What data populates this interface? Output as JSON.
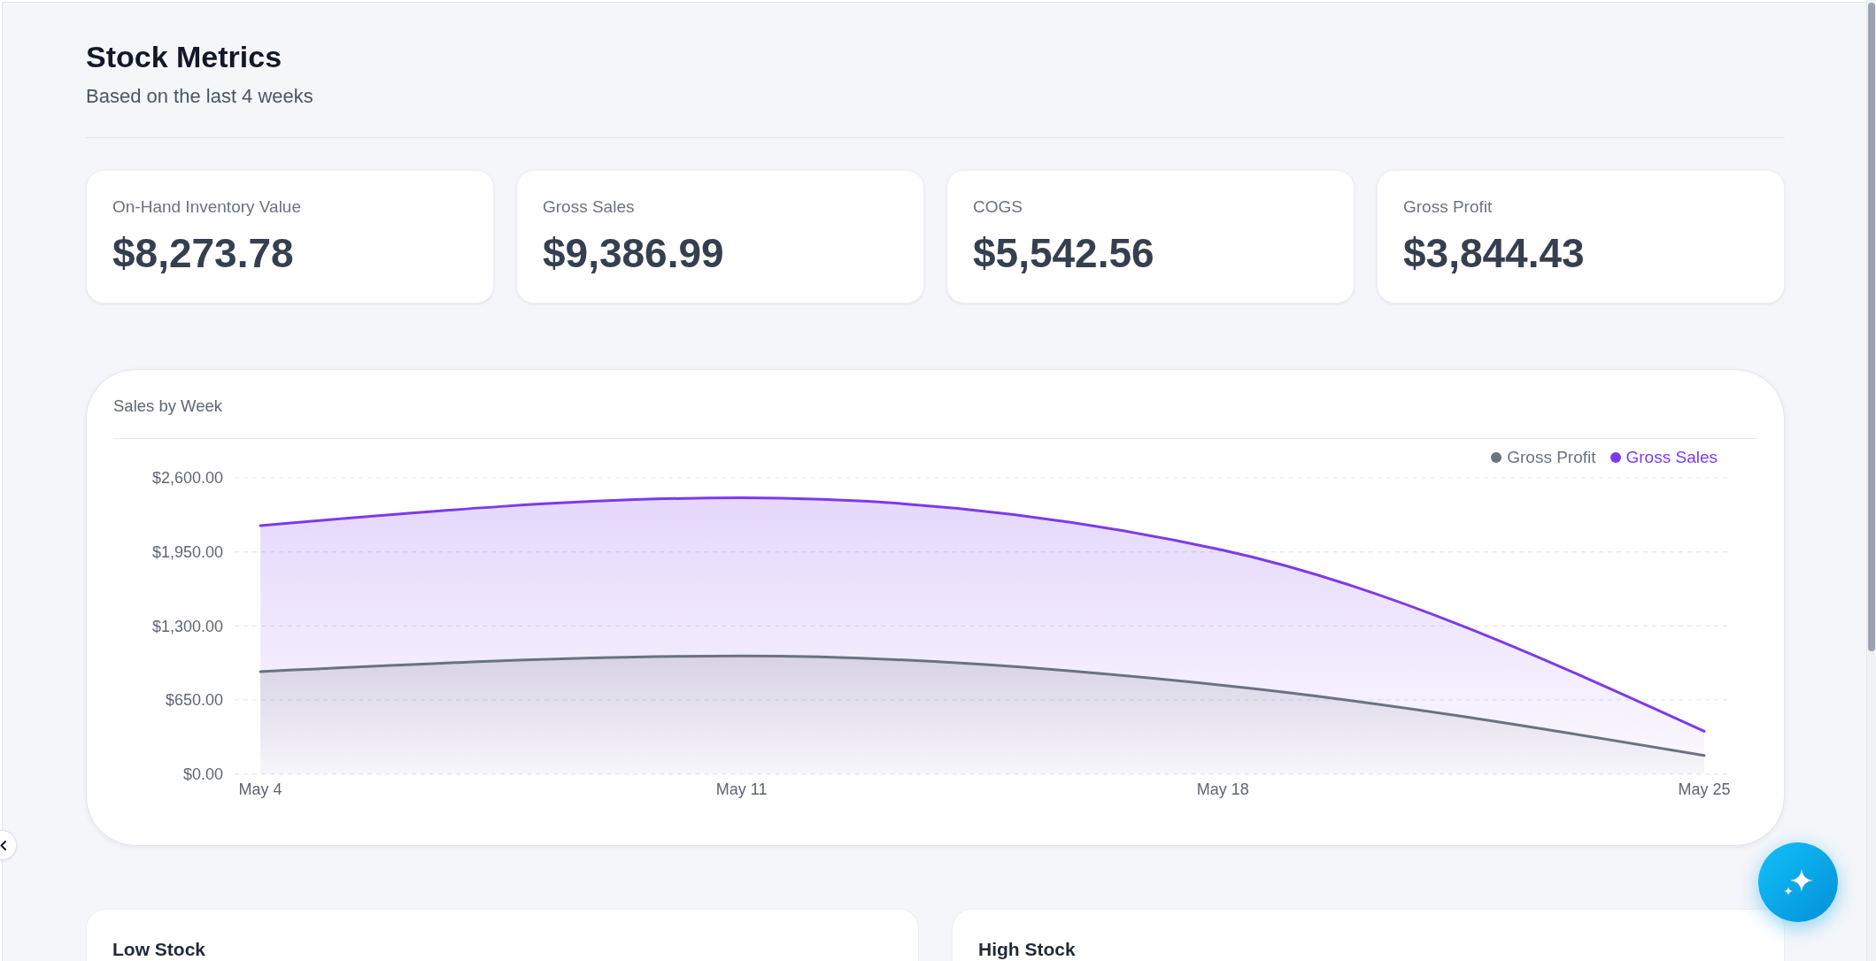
{
  "header": {
    "title": "Stock Metrics",
    "subtitle": "Based on the last 4 weeks"
  },
  "metrics": [
    {
      "label": "On-Hand Inventory Value",
      "value": "$8,273.78"
    },
    {
      "label": "Gross Sales",
      "value": "$9,386.99"
    },
    {
      "label": "COGS",
      "value": "$5,542.56"
    },
    {
      "label": "Gross Profit",
      "value": "$3,844.43"
    }
  ],
  "sales_chart": {
    "title": "Sales by Week",
    "chart_data": {
      "type": "area",
      "grid": true,
      "categories": [
        "May 4",
        "May 11",
        "May 18",
        "May 25"
      ],
      "series": [
        {
          "name": "Gross Profit",
          "color": "#6b7280",
          "values": [
            899,
            1036,
            778,
            162
          ]
        },
        {
          "name": "Gross Sales",
          "color": "#7c3aed",
          "values": [
            2180,
            2425,
            1965,
            375
          ]
        }
      ],
      "ylim": [
        0,
        2600
      ],
      "yticks": [
        {
          "value": 0,
          "label": "$0.00"
        },
        {
          "value": 650,
          "label": "$650.00"
        },
        {
          "value": 1300,
          "label": "$1,300.00"
        },
        {
          "value": 1950,
          "label": "$1,950.00"
        },
        {
          "value": 2600,
          "label": "$2,600.00"
        }
      ]
    }
  },
  "stock_panels": [
    {
      "title": "Low Stock"
    },
    {
      "title": "High Stock"
    }
  ]
}
